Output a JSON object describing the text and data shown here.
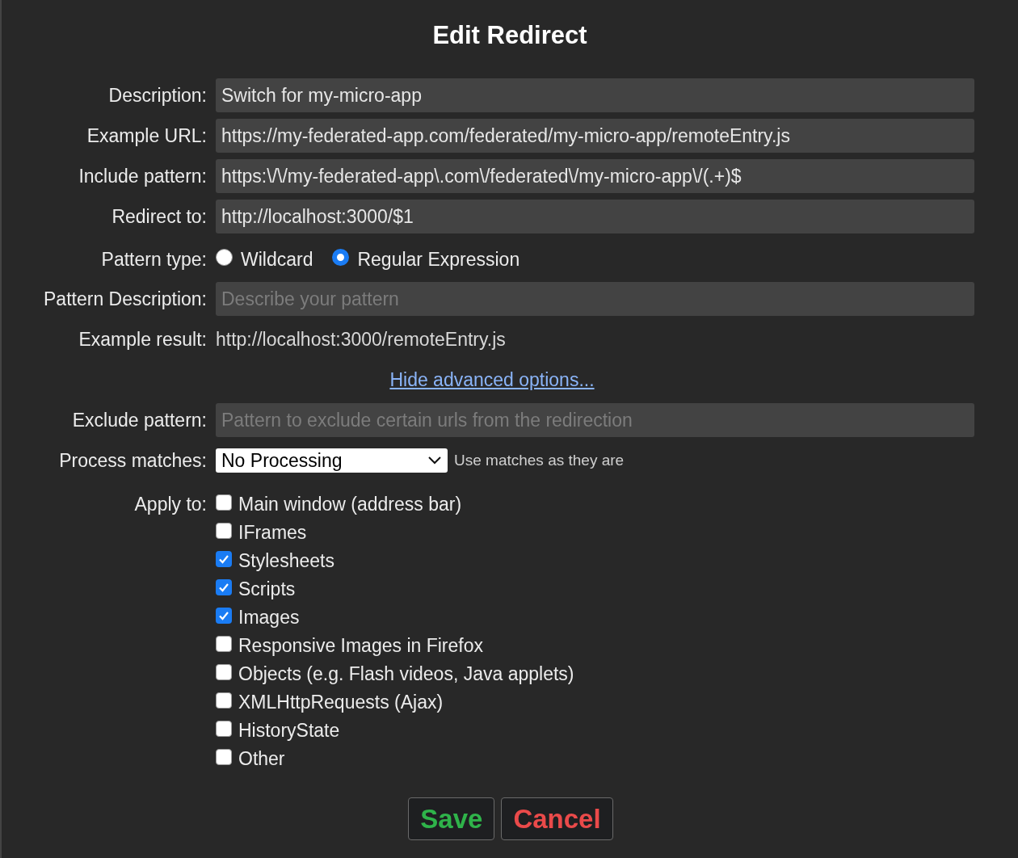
{
  "title": "Edit Redirect",
  "rows": [
    {
      "kind": "input",
      "label": "Description:",
      "value": "Switch for my-micro-app"
    },
    {
      "kind": "input",
      "label": "Example URL:",
      "value": "https://my-federated-app.com/federated/my-micro-app/remoteEntry.js"
    },
    {
      "kind": "input",
      "label": "Include pattern:",
      "value": "https:\\/\\/my-federated-app\\.com\\/federated\\/my-micro-app\\/(.+)$"
    },
    {
      "kind": "input",
      "label": "Redirect to:",
      "value": "http://localhost:3000/$1"
    },
    {
      "kind": "radio",
      "label": "Pattern type:",
      "options": [
        {
          "label": "Wildcard",
          "selected": false
        },
        {
          "label": "Regular Expression",
          "selected": true
        }
      ]
    },
    {
      "kind": "input",
      "label": "Pattern Description:",
      "placeholder": "Describe your pattern"
    },
    {
      "kind": "text",
      "label": "Example result:",
      "value": "http://localhost:3000/remoteEntry.js"
    },
    {
      "kind": "link",
      "value": "Hide advanced options..."
    },
    {
      "kind": "input",
      "label": "Exclude pattern:",
      "placeholder": "Pattern to exclude certain urls from the redirection"
    },
    {
      "kind": "select",
      "label": "Process matches:",
      "value": "No Processing",
      "hint": "Use matches as they are"
    },
    {
      "kind": "checks",
      "label": "Apply to:",
      "options": [
        {
          "label": "Main window (address bar)",
          "checked": false
        },
        {
          "label": "IFrames",
          "checked": false
        },
        {
          "label": "Stylesheets",
          "checked": true
        },
        {
          "label": "Scripts",
          "checked": true
        },
        {
          "label": "Images",
          "checked": true
        },
        {
          "label": "Responsive Images in Firefox",
          "checked": false
        },
        {
          "label": "Objects (e.g. Flash videos, Java applets)",
          "checked": false
        },
        {
          "label": "XMLHttpRequests (Ajax)",
          "checked": false
        },
        {
          "label": "HistoryState",
          "checked": false
        },
        {
          "label": "Other",
          "checked": false
        }
      ]
    }
  ],
  "buttons": [
    {
      "kind": "save",
      "label": "Save"
    },
    {
      "kind": "cancel",
      "label": "Cancel"
    }
  ]
}
